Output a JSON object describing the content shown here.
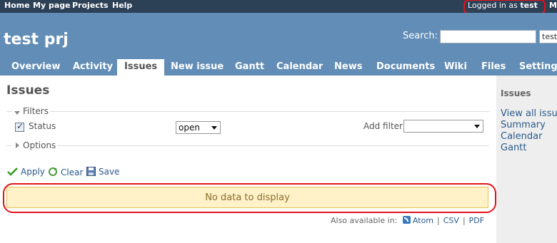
{
  "top_menu": {
    "items": [
      "Home",
      "My page",
      "Projects",
      "Help"
    ],
    "logged_in_prefix": "Logged in as",
    "logged_in_user": "test",
    "more_label": "M"
  },
  "header": {
    "project_title": "test prj",
    "search_label": "Search:",
    "search_value": "",
    "jump_value": "test"
  },
  "tabs": [
    {
      "label": "Overview",
      "selected": false
    },
    {
      "label": "Activity",
      "selected": false
    },
    {
      "label": "Issues",
      "selected": true
    },
    {
      "label": "New issue",
      "selected": false
    },
    {
      "label": "Gantt",
      "selected": false
    },
    {
      "label": "Calendar",
      "selected": false
    },
    {
      "label": "News",
      "selected": false
    },
    {
      "label": "Documents",
      "selected": false
    },
    {
      "label": "Wiki",
      "selected": false
    },
    {
      "label": "Files",
      "selected": false
    },
    {
      "label": "Settings",
      "selected": false
    }
  ],
  "main": {
    "title": "Issues",
    "filters_legend": "Filters",
    "status_label": "Status",
    "status_checked": true,
    "status_operator": "open",
    "add_filter_label": "Add filter",
    "add_filter_value": "",
    "options_legend": "Options",
    "actions": {
      "apply": "Apply",
      "clear": "Clear",
      "save": "Save"
    },
    "no_data": "No data to display",
    "also_available": "Also available in:",
    "formats": [
      "Atom",
      "CSV",
      "PDF"
    ]
  },
  "sidebar": {
    "title": "Issues",
    "links": [
      "View all issues",
      "Summary",
      "Calendar",
      "Gantt"
    ]
  },
  "colors": {
    "top_menu_bg": "#2c4056",
    "header_bg": "#628db6",
    "nodata_bg": "#fff1c8",
    "annotation_red": "#e3131b",
    "sidebar_bg": "#eeeeee"
  }
}
